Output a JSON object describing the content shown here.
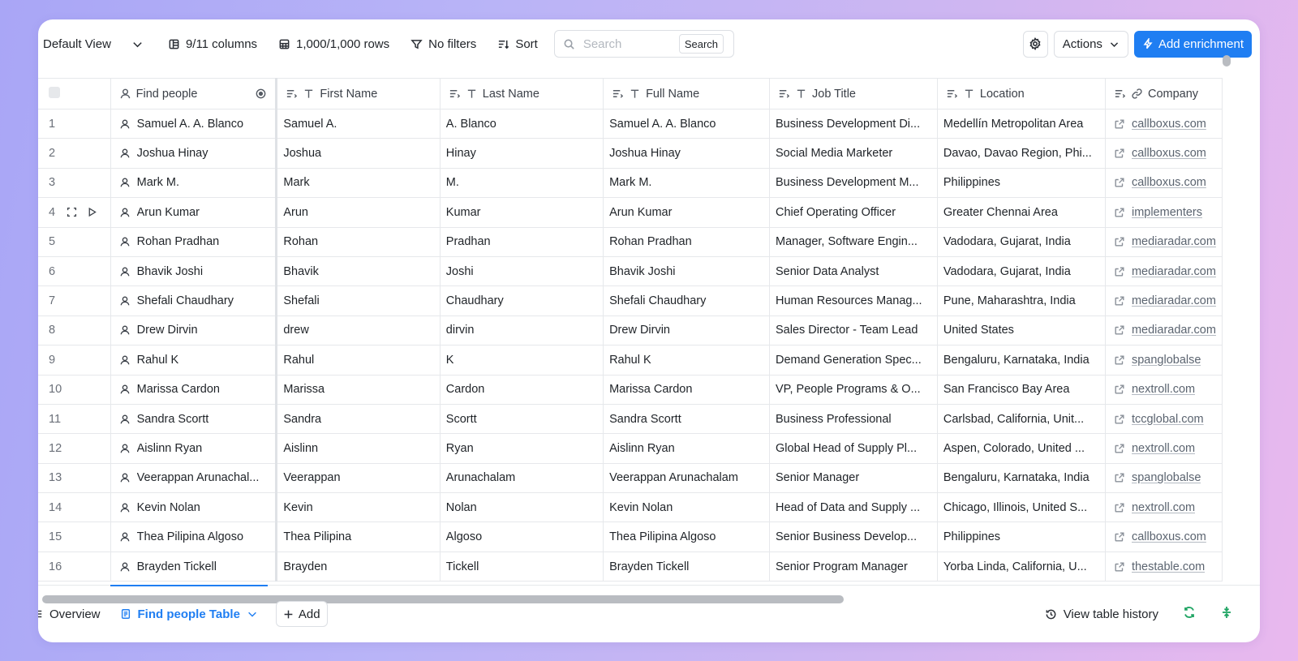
{
  "toolbar": {
    "view_label": "Default View",
    "columns_label": "9/11 columns",
    "rows_label": "1,000/1,000 rows",
    "filters_label": "No filters",
    "sort_label": "Sort",
    "search_placeholder": "Search",
    "search_button": "Search",
    "actions_label": "Actions",
    "enrich_label": "Add enrichment"
  },
  "table": {
    "headers": {
      "find_people": "Find people",
      "first_name": "First Name",
      "last_name": "Last Name",
      "full_name": "Full Name",
      "job_title": "Job Title",
      "location": "Location",
      "company": "Company"
    },
    "rows": [
      {
        "num": "1",
        "person": "Samuel A. A. Blanco",
        "first": "Samuel A.",
        "last": "A. Blanco",
        "full": "Samuel A. A. Blanco",
        "title": "Business Development Di...",
        "location": "Medellín Metropolitan Area",
        "company": "callboxus.com"
      },
      {
        "num": "2",
        "person": "Joshua Hinay",
        "first": "Joshua",
        "last": "Hinay",
        "full": "Joshua Hinay",
        "title": "Social Media Marketer",
        "location": "Davao, Davao Region, Phi...",
        "company": "callboxus.com"
      },
      {
        "num": "3",
        "person": "Mark M.",
        "first": "Mark",
        "last": "M.",
        "full": "Mark M.",
        "title": "Business Development M...",
        "location": "Philippines",
        "company": "callboxus.com"
      },
      {
        "num": "4",
        "person": "Arun Kumar",
        "first": "Arun",
        "last": "Kumar",
        "full": "Arun Kumar",
        "title": "Chief Operating Officer",
        "location": "Greater Chennai Area",
        "company": "implementers"
      },
      {
        "num": "5",
        "person": "Rohan Pradhan",
        "first": "Rohan",
        "last": "Pradhan",
        "full": "Rohan Pradhan",
        "title": "Manager, Software Engin...",
        "location": "Vadodara, Gujarat, India",
        "company": "mediaradar.com"
      },
      {
        "num": "6",
        "person": "Bhavik Joshi",
        "first": "Bhavik",
        "last": "Joshi",
        "full": "Bhavik Joshi",
        "title": "Senior Data Analyst",
        "location": "Vadodara, Gujarat, India",
        "company": "mediaradar.com"
      },
      {
        "num": "7",
        "person": "Shefali Chaudhary",
        "first": "Shefali",
        "last": "Chaudhary",
        "full": "Shefali Chaudhary",
        "title": "Human Resources Manag...",
        "location": "Pune, Maharashtra, India",
        "company": "mediaradar.com"
      },
      {
        "num": "8",
        "person": "Drew Dirvin",
        "first": "drew",
        "last": "dirvin",
        "full": "Drew Dirvin",
        "title": "Sales Director - Team Lead",
        "location": "United States",
        "company": "mediaradar.com"
      },
      {
        "num": "9",
        "person": "Rahul K",
        "first": "Rahul",
        "last": "K",
        "full": "Rahul K",
        "title": "Demand Generation Spec...",
        "location": "Bengaluru, Karnataka, India",
        "company": "spanglobalse"
      },
      {
        "num": "10",
        "person": "Marissa Cardon",
        "first": "Marissa",
        "last": "Cardon",
        "full": "Marissa Cardon",
        "title": "VP, People Programs & O...",
        "location": "San Francisco Bay Area",
        "company": "nextroll.com"
      },
      {
        "num": "11",
        "person": "Sandra Scortt",
        "first": "Sandra",
        "last": "Scortt",
        "full": "Sandra Scortt",
        "title": "Business Professional",
        "location": "Carlsbad, California, Unit...",
        "company": "tccglobal.com"
      },
      {
        "num": "12",
        "person": "Aislinn Ryan",
        "first": "Aislinn",
        "last": "Ryan",
        "full": "Aislinn Ryan",
        "title": "Global Head of Supply Pl...",
        "location": "Aspen, Colorado, United ...",
        "company": "nextroll.com"
      },
      {
        "num": "13",
        "person": "Veerappan Arunachal...",
        "first": "Veerappan",
        "last": "Arunachalam",
        "full": "Veerappan Arunachalam",
        "title": "Senior Manager",
        "location": "Bengaluru, Karnataka, India",
        "company": "spanglobalse"
      },
      {
        "num": "14",
        "person": "Kevin Nolan",
        "first": "Kevin",
        "last": "Nolan",
        "full": "Kevin Nolan",
        "title": "Head of Data and Supply ...",
        "location": "Chicago, Illinois, United S...",
        "company": "nextroll.com"
      },
      {
        "num": "15",
        "person": "Thea Pilipina Algoso",
        "first": "Thea Pilipina",
        "last": "Algoso",
        "full": "Thea Pilipina Algoso",
        "title": "Senior Business Develop...",
        "location": "Philippines",
        "company": "callboxus.com"
      },
      {
        "num": "16",
        "person": "Brayden Tickell",
        "first": "Brayden",
        "last": "Tickell",
        "full": "Brayden Tickell",
        "title": "Senior Program Manager",
        "location": "Yorba Linda, California, U...",
        "company": "thestable.com"
      }
    ]
  },
  "bottom": {
    "overview_tab": "Overview",
    "table_tab": "Find people Table",
    "add_label": "Add",
    "history_label": "View table history"
  },
  "colors": {
    "accent": "#1f7ef2",
    "refresh": "#1fa463"
  }
}
